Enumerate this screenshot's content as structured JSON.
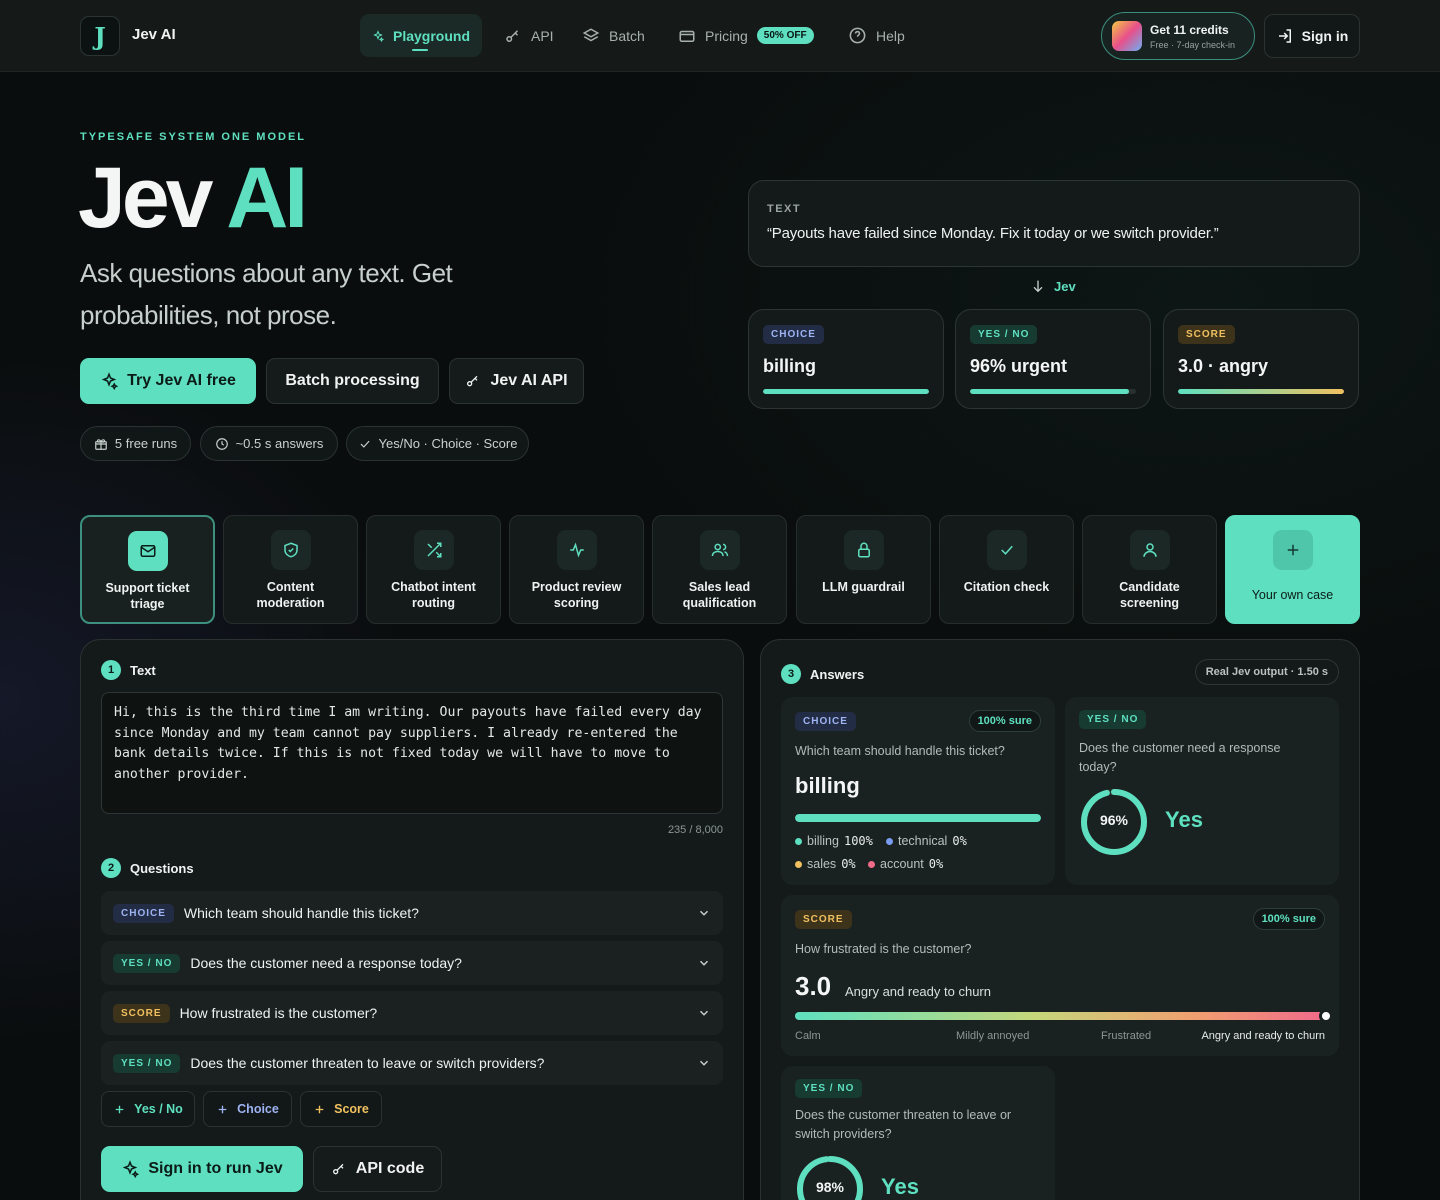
{
  "nav": {
    "logo_glyph": "J",
    "brand": "Jev AI",
    "items": [
      {
        "label": "Playground",
        "icon": "sparkle-icon",
        "active": true
      },
      {
        "label": "API",
        "icon": "key-icon"
      },
      {
        "label": "Batch",
        "icon": "layers-icon"
      },
      {
        "label": "Pricing",
        "icon": "card-icon",
        "badge": "50% OFF"
      },
      {
        "label": "Help",
        "icon": "help-icon"
      }
    ],
    "credits_title": "Get 11 credits",
    "credits_sub": "Free · 7-day check-in",
    "signin": "Sign in"
  },
  "hero": {
    "eyebrow": "TYPESAFE SYSTEM ONE MODEL",
    "title_main": "Jev",
    "title_accent": "AI",
    "subtitle": "Ask questions about any text. Get probabilities, not prose.",
    "btn_try": "Try Jev AI free",
    "btn_batch": "Batch processing",
    "btn_api": "Jev AI API",
    "pills": [
      "5 free runs",
      "~0.5 s answers",
      "Yes/No · Choice · Score"
    ]
  },
  "demo": {
    "text_label": "TEXT",
    "quote": "“Payouts have failed since Monday. Fix it today or we switch provider.”",
    "arrow_label": "Jev",
    "results": [
      {
        "tag": "CHOICE",
        "value": "billing",
        "fill": 1.0
      },
      {
        "tag": "YES / NO",
        "value": "96% urgent",
        "fill": 0.96
      },
      {
        "tag": "SCORE",
        "value": "3.0 · angry",
        "fill": 1.0
      }
    ]
  },
  "cases": [
    {
      "label": "Support ticket triage",
      "icon": "mail-icon",
      "selected": true
    },
    {
      "label": "Content moderation",
      "icon": "shield-icon"
    },
    {
      "label": "Chatbot intent routing",
      "icon": "shuffle-icon"
    },
    {
      "label": "Product review scoring",
      "icon": "pulse-icon"
    },
    {
      "label": "Sales lead qualification",
      "icon": "users-icon"
    },
    {
      "label": "LLM guardrail",
      "icon": "lock-icon"
    },
    {
      "label": "Citation check",
      "icon": "check-icon"
    },
    {
      "label": "Candidate screening",
      "icon": "user-icon"
    },
    {
      "label": "Your own case",
      "icon": "plus-icon"
    }
  ],
  "input_panel": {
    "step1": "1",
    "text_heading": "Text",
    "text_value": "Hi, this is the third time I am writing. Our payouts have failed every day since Monday and my team cannot pay suppliers. I already re-entered the bank details twice. If this is not fixed today we will have to move to another provider.",
    "counter": "235 / 8,000",
    "step2": "2",
    "questions_heading": "Questions",
    "questions": [
      {
        "tag": "CHOICE",
        "text": "Which team should handle this ticket?"
      },
      {
        "tag": "YES / NO",
        "text": "Does the customer need a response today?"
      },
      {
        "tag": "SCORE",
        "text": "How frustrated is the customer?"
      },
      {
        "tag": "YES / NO",
        "text": "Does the customer threaten to leave or switch providers?"
      }
    ],
    "add_yn": "Yes / No",
    "add_choice": "Choice",
    "add_score": "Score",
    "run_btn": "Sign in to run Jev",
    "api_btn": "API code"
  },
  "answers": {
    "step3": "3",
    "heading": "Answers",
    "meta": "Real Jev output · 1.50 s",
    "choice": {
      "tag": "CHOICE",
      "sure": "100% sure",
      "question": "Which team should handle this ticket?",
      "answer": "billing",
      "fill": 1.0,
      "legend": [
        {
          "name": "billing",
          "pct": "100%",
          "color": "#5ee0c0"
        },
        {
          "name": "technical",
          "pct": "0%",
          "color": "#7a9cf0"
        },
        {
          "name": "sales",
          "pct": "0%",
          "color": "#f0c060"
        },
        {
          "name": "account",
          "pct": "0%",
          "color": "#f06a8a"
        }
      ]
    },
    "urgent": {
      "tag": "YES / NO",
      "question": "Does the customer need a response today?",
      "pct": "96%",
      "value": 0.96,
      "answer": "Yes"
    },
    "score": {
      "tag": "SCORE",
      "sure": "100% sure",
      "question": "How frustrated is the customer?",
      "value": "3.0",
      "label": "Angry and ready to churn",
      "scale": [
        "Calm",
        "Mildly annoyed",
        "Frustrated",
        "Angry and ready to churn"
      ]
    },
    "churn": {
      "tag": "YES / NO",
      "question": "Does the customer threaten to leave or switch providers?",
      "pct": "98%",
      "value": 0.98,
      "answer": "Yes"
    }
  }
}
